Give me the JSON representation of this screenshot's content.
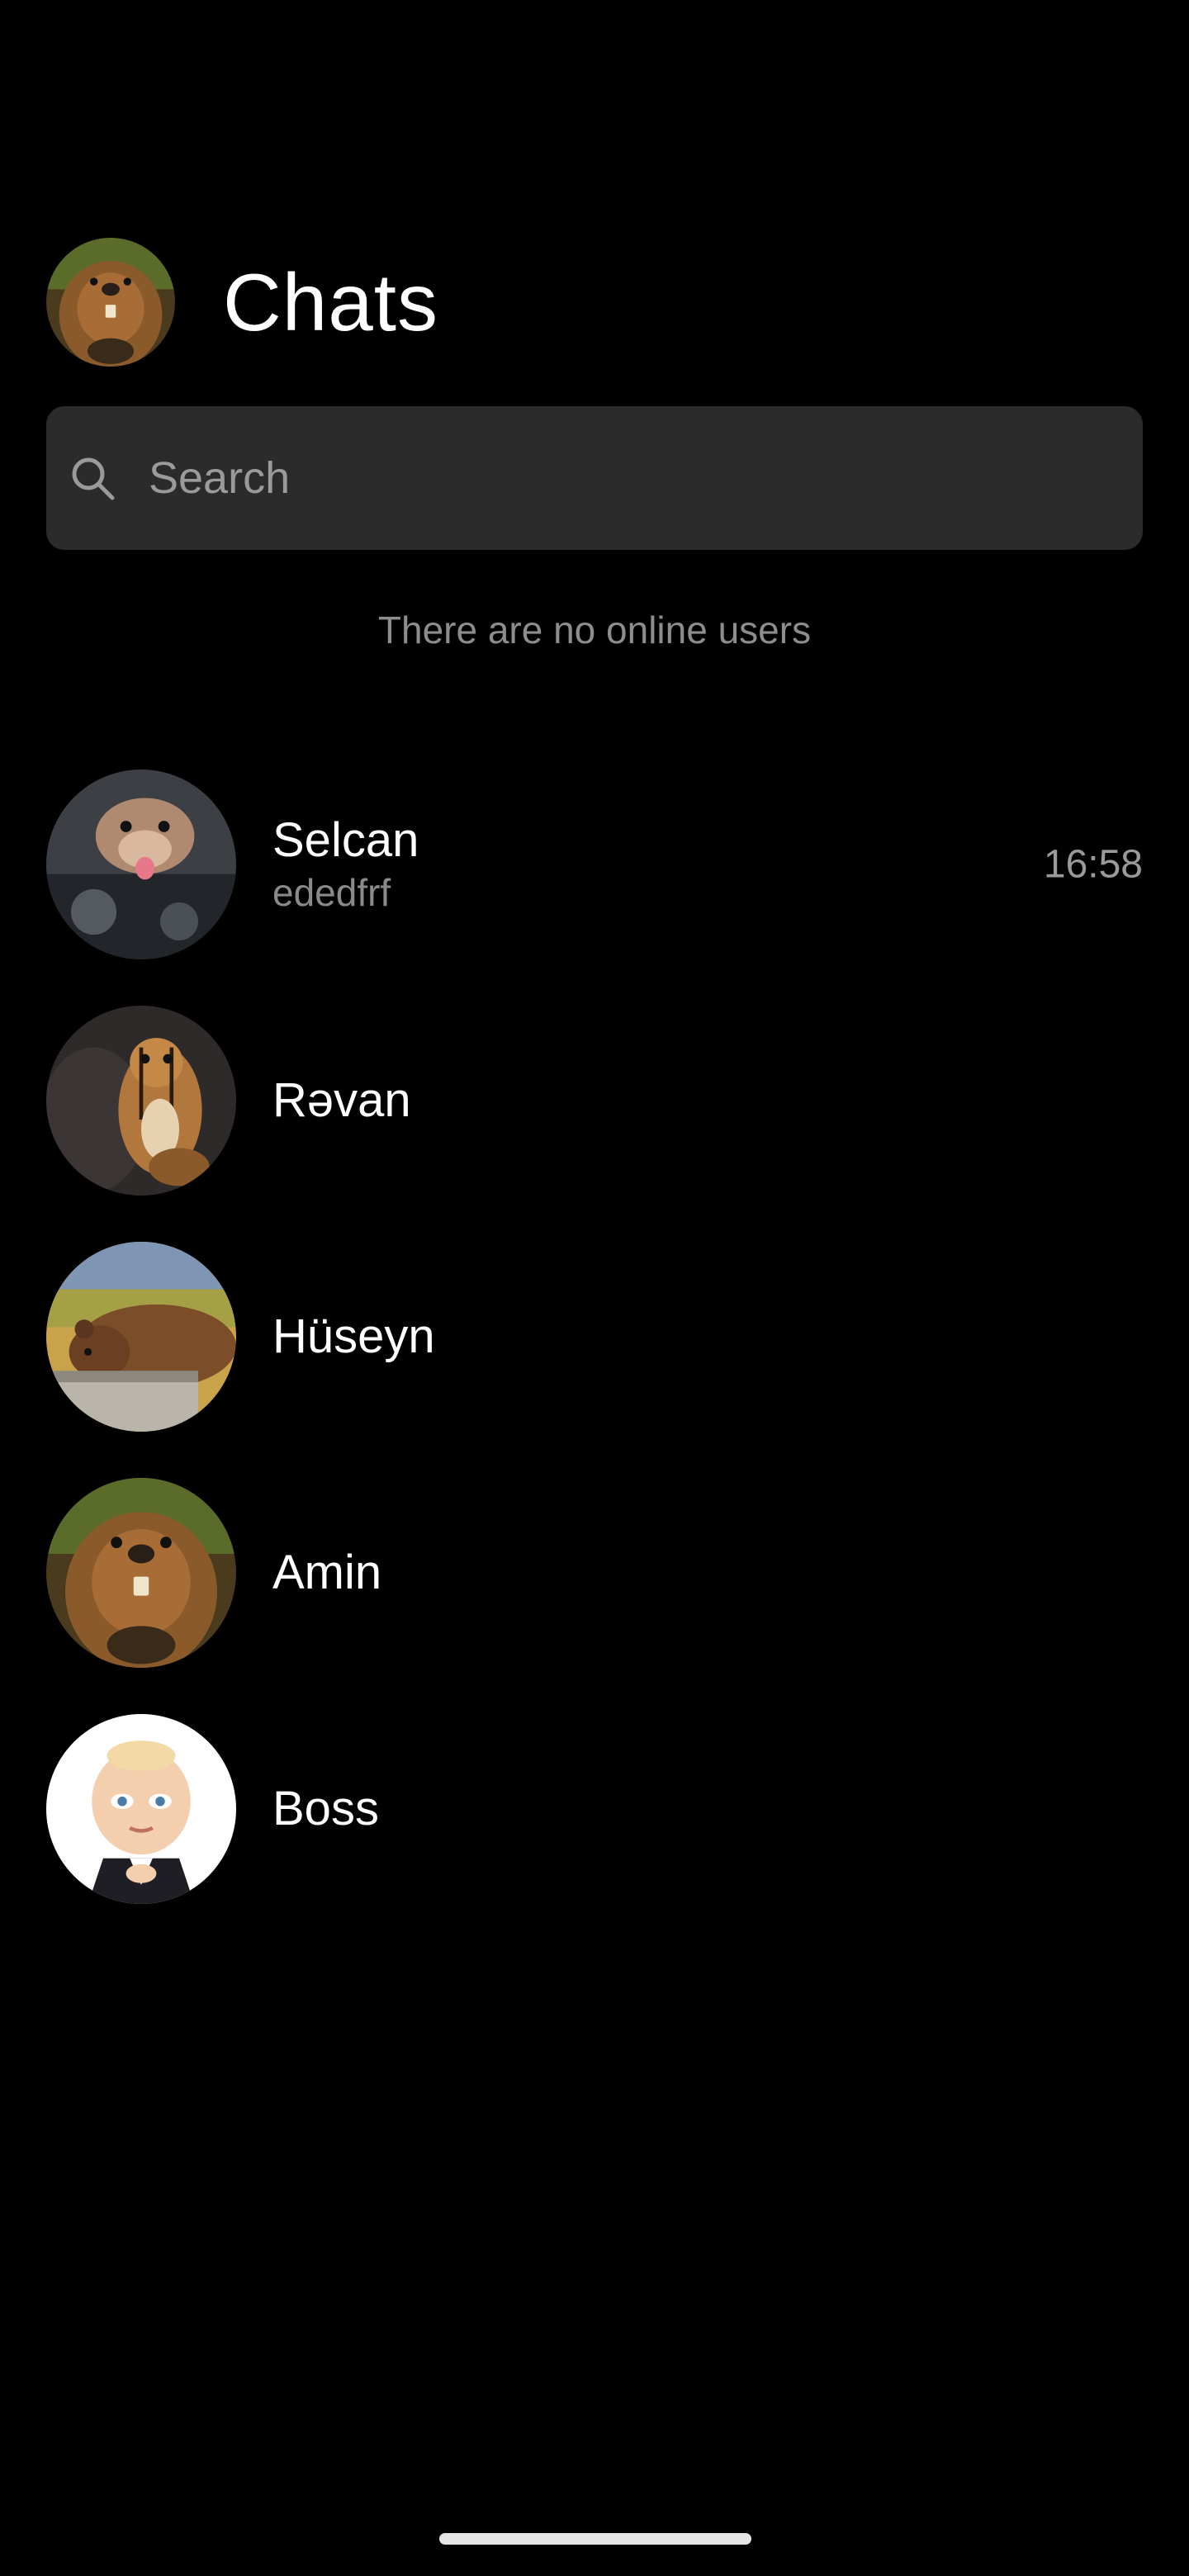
{
  "header": {
    "title": "Chats",
    "avatar_icon": "beaver-avatar-icon"
  },
  "search": {
    "placeholder": "Search",
    "value": ""
  },
  "online_status_text": "There are no online users",
  "chats": [
    {
      "name": "Selcan",
      "preview": "ededfrf",
      "time": "16:58",
      "avatar_icon": "marten-avatar-icon"
    },
    {
      "name": "Rəvan",
      "preview": "",
      "time": "",
      "avatar_icon": "chipmunk-avatar-icon"
    },
    {
      "name": "Hüseyn",
      "preview": "",
      "time": "",
      "avatar_icon": "bear-avatar-icon"
    },
    {
      "name": "Amin",
      "preview": "",
      "time": "",
      "avatar_icon": "beaver-avatar-icon"
    },
    {
      "name": "Boss",
      "preview": "",
      "time": "",
      "avatar_icon": "boss-baby-avatar-icon"
    }
  ],
  "colors": {
    "background": "#000000",
    "search_background": "#2b2b2b",
    "secondary_text": "#8a8a8a"
  }
}
